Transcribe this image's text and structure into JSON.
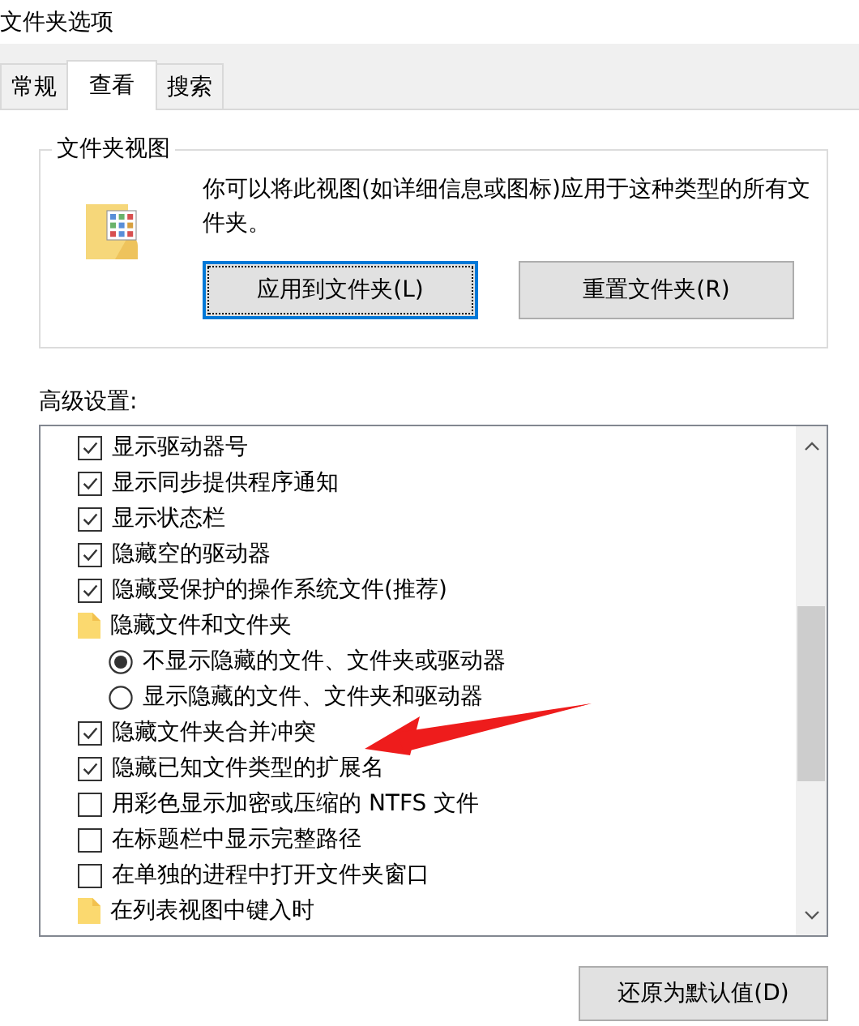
{
  "window": {
    "title": "文件夹选项"
  },
  "tabs": [
    {
      "label": "常规",
      "selected": false
    },
    {
      "label": "查看",
      "selected": true
    },
    {
      "label": "搜索",
      "selected": false
    }
  ],
  "folder_views": {
    "title": "文件夹视图",
    "description": "你可以将此视图(如详细信息或图标)应用于这种类型的所有文件夹。",
    "buttons": [
      {
        "label": "应用到文件夹(L)",
        "focused": true
      },
      {
        "label": "重置文件夹(R)",
        "focused": false
      }
    ]
  },
  "advanced": {
    "label": "高级设置:",
    "items": [
      {
        "kind": "checkbox",
        "label": "显示驱动器号",
        "checked": true
      },
      {
        "kind": "checkbox",
        "label": "显示同步提供程序通知",
        "checked": true
      },
      {
        "kind": "checkbox",
        "label": "显示状态栏",
        "checked": true
      },
      {
        "kind": "checkbox",
        "label": "隐藏空的驱动器",
        "checked": true
      },
      {
        "kind": "checkbox",
        "label": "隐藏受保护的操作系统文件(推荐)",
        "checked": true
      },
      {
        "kind": "folder",
        "label": "隐藏文件和文件夹",
        "children": [
          {
            "kind": "radio",
            "label": "不显示隐藏的文件、文件夹或驱动器",
            "selected": true
          },
          {
            "kind": "radio",
            "label": "显示隐藏的文件、文件夹和驱动器",
            "selected": false
          }
        ]
      },
      {
        "kind": "checkbox",
        "label": "隐藏文件夹合并冲突",
        "checked": true
      },
      {
        "kind": "checkbox",
        "label": "隐藏已知文件类型的扩展名",
        "checked": true
      },
      {
        "kind": "checkbox",
        "label": "用彩色显示加密或压缩的 NTFS 文件",
        "checked": false
      },
      {
        "kind": "checkbox",
        "label": "在标题栏中显示完整路径",
        "checked": false
      },
      {
        "kind": "checkbox",
        "label": "在单独的进程中打开文件夹窗口",
        "checked": false
      },
      {
        "kind": "folder",
        "label": "在列表视图中键入时"
      }
    ]
  },
  "restore_button": "还原为默认值(D)"
}
